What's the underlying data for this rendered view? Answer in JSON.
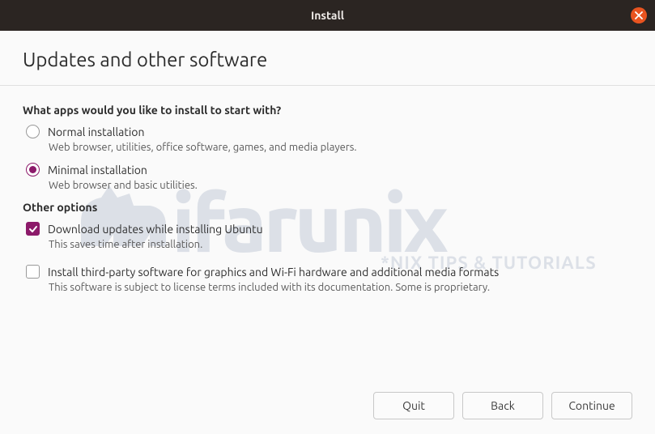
{
  "titlebar": {
    "title": "Install"
  },
  "header": {
    "page_title": "Updates and other software"
  },
  "apps_section": {
    "heading": "What apps would you like to install to start with?",
    "normal": {
      "label": "Normal installation",
      "desc": "Web browser, utilities, office software, games, and media players."
    },
    "minimal": {
      "label": "Minimal installation",
      "desc": "Web browser and basic utilities."
    }
  },
  "other_section": {
    "heading": "Other options",
    "download_updates": {
      "label": "Download updates while installing Ubuntu",
      "desc": "This saves time after installation."
    },
    "third_party": {
      "label": "Install third-party software for graphics and Wi-Fi hardware and additional media formats",
      "desc": "This software is subject to license terms included with its documentation. Some is proprietary."
    }
  },
  "buttons": {
    "quit": "Quit",
    "back": "Back",
    "continue": "Continue"
  },
  "watermark": {
    "brand": "ifarunix",
    "tag": "*NIX TIPS & TUTORIALS"
  }
}
